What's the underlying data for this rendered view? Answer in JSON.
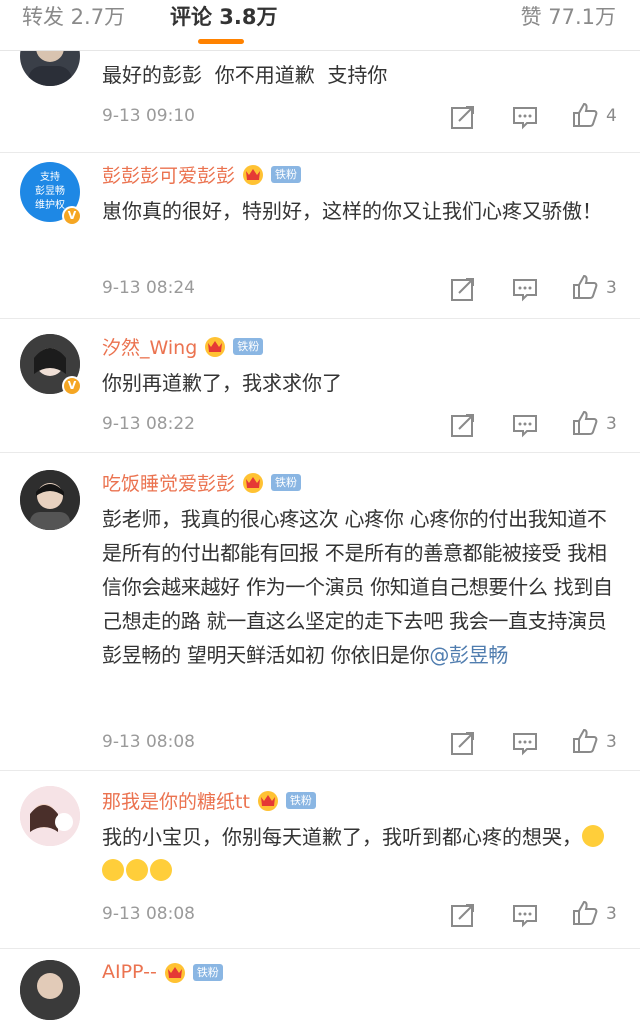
{
  "tabs": {
    "repost": "转发 2.7万",
    "comment": "评论 3.8万",
    "like": "赞 77.1万"
  },
  "comments": [
    {
      "user": "",
      "text": "最好的彭彭  你不用道歉  支持你",
      "time": "9-13 09:10",
      "likes": "4"
    },
    {
      "user": "彭彭彭可爱彭彭",
      "badge": "铁粉",
      "avatar_text": "支持\n彭昱畅\n维护权",
      "text": "崽你真的很好，特别好，这样的你又让我们心疼又骄傲！",
      "time": "9-13 08:24",
      "likes": "3"
    },
    {
      "user": "汐然_Wing",
      "badge": "铁粉",
      "text": "你别再道歉了，我求求你了",
      "time": "9-13 08:22",
      "likes": "3"
    },
    {
      "user": "吃饭睡觉爱彭彭",
      "badge": "铁粉",
      "text": "彭老师，我真的很心疼这次 心疼你 心疼你的付出我知道不是所有的付出都能有回报 不是所有的善意都能被接受 我相信你会越来越好 作为一个演员 你知道自己想要什么 找到自己想走的路 就一直这么坚定的走下去吧 我会一直支持演员彭昱畅的 望明天鲜活如初 你依旧是你",
      "mention": "@彭昱畅",
      "time": "9-13 08:08",
      "likes": "3"
    },
    {
      "user": "那我是你的糖纸tt",
      "badge": "铁粉",
      "text": "我的小宝贝，你别每天道歉了，我听到都心疼的想哭，",
      "time": "9-13 08:08",
      "likes": "3"
    },
    {
      "user": "AIPP--",
      "badge": "铁粉"
    }
  ],
  "icons": {
    "share": "share-icon",
    "comment": "comment-icon",
    "like": "thumbs-up-icon"
  },
  "colors": {
    "accent": "#ff8200",
    "username": "#eb7350",
    "mention": "#507daf",
    "fan_badge": "#8ab6e3"
  }
}
